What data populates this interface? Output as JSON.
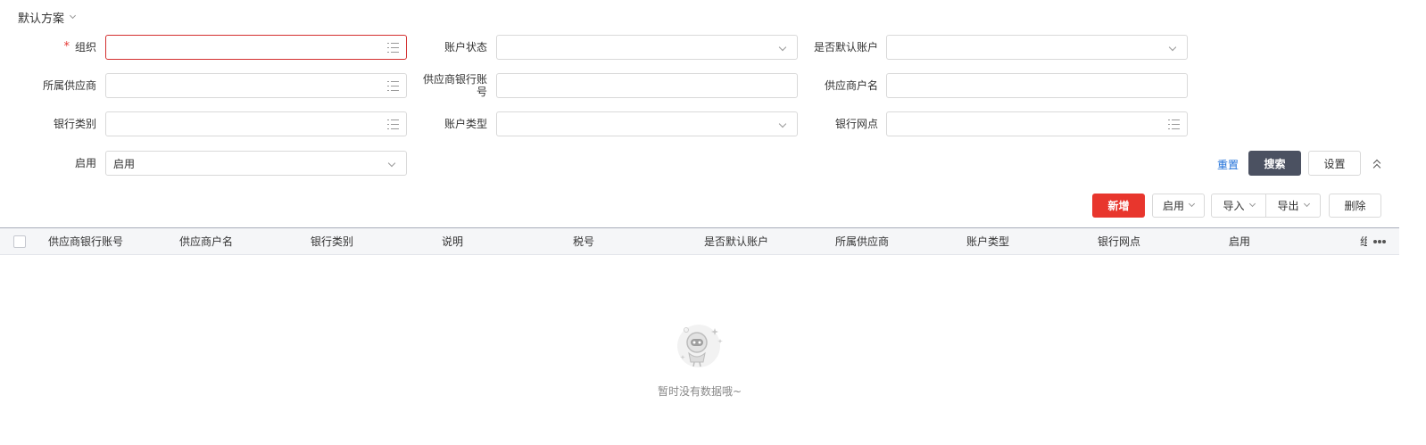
{
  "scheme": {
    "label": "默认方案",
    "icon": "chevron-down-icon"
  },
  "form": {
    "org": {
      "label": "组织",
      "required_mark": "*",
      "value": "",
      "icon": "list-icon"
    },
    "account_status": {
      "label": "账户状态",
      "value": "",
      "icon": "chevron-down-icon"
    },
    "is_default": {
      "label": "是否默认账户",
      "value": "",
      "icon": "chevron-down-icon"
    },
    "supplier": {
      "label": "所属供应商",
      "value": "",
      "icon": "list-icon"
    },
    "bank_account": {
      "label": "供应商银行账号",
      "value": ""
    },
    "account_name": {
      "label": "供应商户名",
      "value": ""
    },
    "bank_type": {
      "label": "银行类别",
      "value": "",
      "icon": "list-icon"
    },
    "account_type": {
      "label": "账户类型",
      "value": "",
      "icon": "chevron-down-icon"
    },
    "bank_branch": {
      "label": "银行网点",
      "value": "",
      "icon": "list-icon"
    },
    "enabled": {
      "label": "启用",
      "value": "启用",
      "icon": "chevron-down-icon"
    }
  },
  "search_actions": {
    "reset": "重置",
    "search": "搜索",
    "settings": "设置",
    "collapse_icon": "double-chevron-up-icon"
  },
  "toolbar": {
    "new": "新增",
    "enable": "启用",
    "import": "导入",
    "export": "导出",
    "delete": "删除"
  },
  "table": {
    "columns": [
      "供应商银行账号",
      "供应商户名",
      "银行类别",
      "说明",
      "税号",
      "是否默认账户",
      "所属供应商",
      "账户类型",
      "银行网点",
      "启用",
      "组"
    ],
    "more_icon": "more-horizontal-icon",
    "rows": []
  },
  "empty": {
    "text": "暂时没有数据哦~",
    "icon": "astronaut-empty-icon"
  },
  "colors": {
    "primary_red": "#e8362d",
    "search_button": "#4b5161",
    "link_blue": "#1e6fd9",
    "error_border": "#d32f2f"
  }
}
